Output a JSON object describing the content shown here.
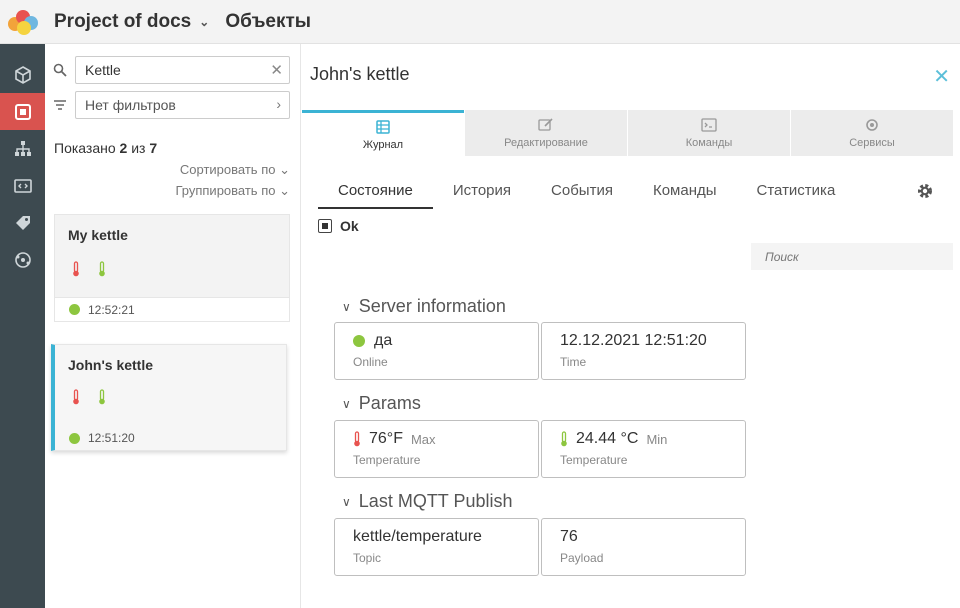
{
  "header": {
    "project": "Project of docs",
    "section": "Объекты"
  },
  "sidebar": {
    "search_value": "Kettle",
    "filter_placeholder": "Нет фильтров",
    "shown_prefix": "Показано",
    "shown_count": "2",
    "shown_of": "из",
    "shown_total": "7",
    "sort_label": "Сортировать по",
    "group_label": "Группировать по",
    "items": [
      {
        "name": "My kettle",
        "time": "12:52:21"
      },
      {
        "name": "John's kettle",
        "time": "12:51:20"
      }
    ]
  },
  "main": {
    "title": "John's kettle",
    "tabs": [
      {
        "label": "Журнал",
        "icon": "journal-icon"
      },
      {
        "label": "Редактирование",
        "icon": "edit-icon"
      },
      {
        "label": "Команды",
        "icon": "terminal-icon"
      },
      {
        "label": "Сервисы",
        "icon": "services-icon"
      }
    ],
    "subtabs": [
      "Состояние",
      "История",
      "События",
      "Команды",
      "Статистика"
    ],
    "state_label": "Ok",
    "search_placeholder": "Поиск",
    "groups": [
      {
        "title": "Server information",
        "tiles": [
          {
            "value": "да",
            "label": "Online",
            "icon": "green-dot"
          },
          {
            "value": "12.12.2021 12:51:20",
            "label": "Time"
          }
        ]
      },
      {
        "title": "Params",
        "tiles": [
          {
            "value": "76°F",
            "suffix": "Max",
            "label": "Temperature",
            "icon": "thermometer-red-icon"
          },
          {
            "value": "24.44 °C",
            "suffix": "Min",
            "label": "Temperature",
            "icon": "thermometer-green-icon"
          }
        ]
      },
      {
        "title": "Last MQTT Publish",
        "tiles": [
          {
            "value": "kettle/temperature",
            "label": "Topic"
          },
          {
            "value": "76",
            "label": "Payload"
          }
        ]
      }
    ]
  },
  "colors": {
    "accent": "#3bb3d4",
    "danger": "#d9534f",
    "rail": "#3d4a50",
    "online": "#8dc63f"
  }
}
